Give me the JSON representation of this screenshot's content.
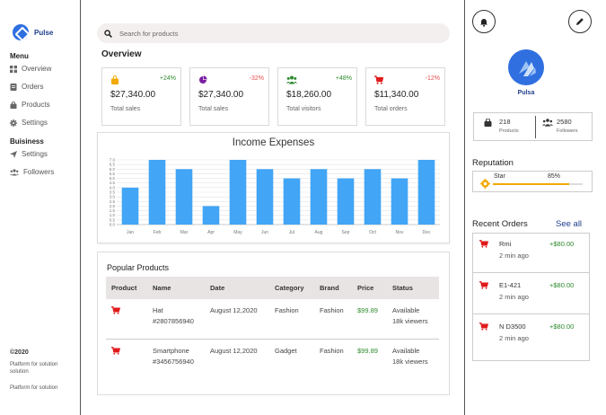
{
  "brand": {
    "name": "Pulse"
  },
  "sidebar": {
    "menu_title": "Menu",
    "menu_items": [
      {
        "label": "Overview",
        "icon": "grid-icon"
      },
      {
        "label": "Orders",
        "icon": "document-icon"
      },
      {
        "label": "Products",
        "icon": "bag-icon"
      },
      {
        "label": "Settings",
        "icon": "gear-icon"
      }
    ],
    "business_title": "Buisiness",
    "business_items": [
      {
        "label": "Settings",
        "icon": "send-icon"
      },
      {
        "label": "Followers",
        "icon": "users-icon"
      }
    ],
    "copyright": "©2020",
    "footer_line1": "Platform for solution solution",
    "footer_line2": "Platform for solution"
  },
  "search": {
    "placeholder": "Search for products"
  },
  "overview": {
    "title": "Overview",
    "cards": [
      {
        "icon": "bag-icon",
        "icon_color": "#f2a900",
        "delta": "+24%",
        "trend": "pos",
        "value": "$27,340.00",
        "label": "Total sales"
      },
      {
        "icon": "pie-icon",
        "icon_color": "#7b1fa2",
        "delta": "-32%",
        "trend": "neg",
        "value": "$27,340.00",
        "label": "Total sales"
      },
      {
        "icon": "users-icon",
        "icon_color": "#2e8b2e",
        "delta": "+48%",
        "trend": "pos",
        "value": "$18,260.00",
        "label": "Total visitors"
      },
      {
        "icon": "cart-icon",
        "icon_color": "#e01b1b",
        "delta": "-12%",
        "trend": "neg",
        "value": "$11,340.00",
        "label": "Total orders"
      }
    ]
  },
  "chart_data": {
    "type": "bar",
    "title": "Income Expenses",
    "categories": [
      "Jan",
      "Feb",
      "Mar",
      "Apr",
      "May",
      "Jun",
      "Jul",
      "Aug",
      "Sep",
      "Oct",
      "Nov",
      "Dec"
    ],
    "values": [
      4.0,
      7.0,
      6.0,
      2.0,
      7.0,
      6.0,
      5.0,
      6.0,
      5.0,
      6.0,
      5.0,
      7.0
    ],
    "ylim": [
      0,
      7
    ],
    "yticks": [
      "0.0",
      "0.5",
      "1.0",
      "1.5",
      "2.0",
      "2.5",
      "3.0",
      "3.5",
      "4.0",
      "4.5",
      "5.0",
      "5.5",
      "6.0",
      "6.5",
      "7.0"
    ],
    "grid": true,
    "bar_color": "#42a5f5"
  },
  "products": {
    "title": "Popular Products",
    "columns": [
      "Product",
      "Name",
      "Date",
      "Category",
      "Brand",
      "Price",
      "Status"
    ],
    "rows": [
      {
        "name": "Hat",
        "sku": "#2807856940",
        "date": "August 12,2020",
        "category": "Fashion",
        "brand": "Fashion",
        "price": "$99.89",
        "status": "Available",
        "viewers": "18k viewers"
      },
      {
        "name": "Smartphone",
        "sku": "#3456756940",
        "date": "August 12,2020",
        "category": "Gadget",
        "brand": "Fashion",
        "price": "$99.89",
        "status": "Available",
        "viewers": "18k viewers"
      }
    ]
  },
  "profile": {
    "name": "Pulsa",
    "products_count": "218",
    "products_label": "Products",
    "followers_count": "2580",
    "followers_label": "Followers"
  },
  "reputation": {
    "title": "Reputation",
    "label": "Star",
    "percent_text": "85%",
    "percent": 85
  },
  "recent_orders": {
    "title": "Recent Orders",
    "see_all": "See all",
    "items": [
      {
        "name": "Rmi",
        "time": "2 min ago",
        "amount": "+$80.00"
      },
      {
        "name": "E1-421",
        "time": "2 min ago",
        "amount": "+$80.00"
      },
      {
        "name": "N D3500",
        "time": "2 min ago",
        "amount": "+$80.00"
      }
    ]
  }
}
